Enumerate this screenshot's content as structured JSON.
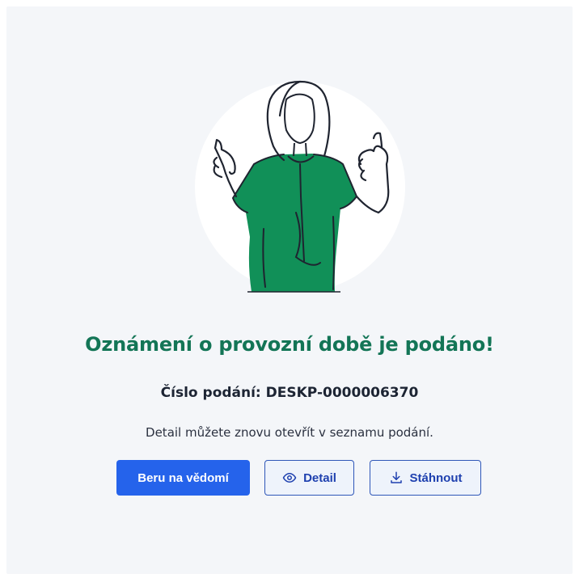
{
  "success": {
    "title": "Oznámení o provozní době je podáno!",
    "submission_label": "Číslo podání: DESKP-0000006370",
    "hint": "Detail můžete znovu otevřít v seznamu podání."
  },
  "actions": {
    "acknowledge_label": "Beru na vědomí",
    "detail_label": "Detail",
    "download_label": "Stáhnout"
  },
  "colors": {
    "accent_green": "#137556",
    "primary_blue": "#2563eb",
    "outline_blue": "#2e56b8",
    "background": "#f4f6f9"
  },
  "icons": {
    "detail": "eye-icon",
    "download": "download-icon",
    "illustration": "woman-thumbs-up-illustration"
  }
}
